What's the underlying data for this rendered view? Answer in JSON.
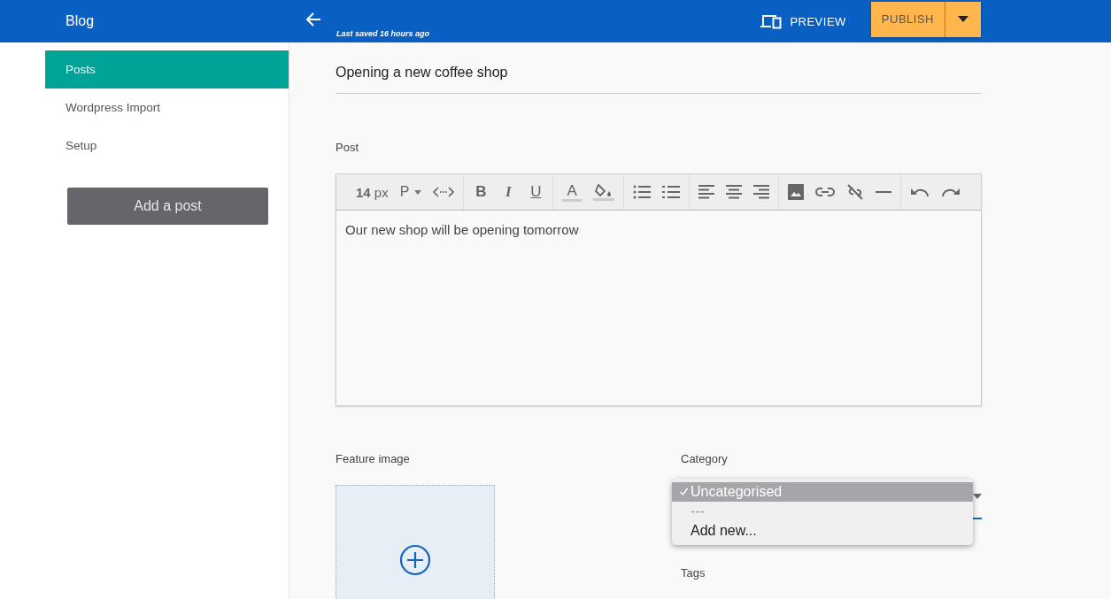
{
  "app_title": "Blog",
  "header": {
    "last_saved": "Last saved 16 hours ago",
    "preview": "PREVIEW",
    "publish": "PUBLISH"
  },
  "sidebar": {
    "items": [
      {
        "label": "Posts",
        "selected": true
      },
      {
        "label": "Wordpress Import",
        "selected": false
      },
      {
        "label": "Setup",
        "selected": false
      }
    ],
    "add_button": "Add a post"
  },
  "post_title": {
    "value": "Opening a new coffee shop"
  },
  "post": {
    "label": "Post",
    "toolbar": {
      "font_size": "14",
      "font_unit": "px",
      "block_format": "P",
      "bold": "B",
      "italic": "I",
      "underline": "U",
      "text_color": "A"
    },
    "body": "Our new shop will be opening tomorrow"
  },
  "feature_image": {
    "label": "Feature image"
  },
  "category": {
    "label": "Category",
    "options": [
      {
        "label": "Uncategorised",
        "selected": true,
        "disabled": false
      },
      {
        "label": "---",
        "selected": false,
        "disabled": true
      },
      {
        "label": "Add new...",
        "selected": false,
        "disabled": false
      }
    ]
  },
  "tags": {
    "label": "Tags"
  }
}
